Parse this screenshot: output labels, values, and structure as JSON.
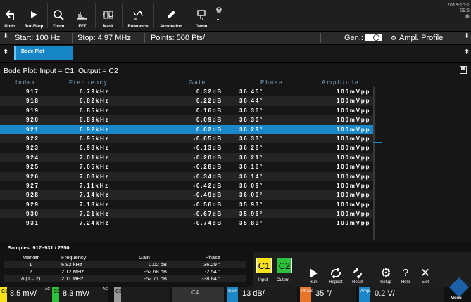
{
  "toolbar": {
    "undo": "Undo",
    "run_stop": "Run/Stop",
    "zoom": "Zoom",
    "fft": "FFT",
    "mask": "Mask",
    "reference": "Reference",
    "annotation": "Annotation",
    "demo": "Demo",
    "date": "2018-10-1",
    "time": "09:5"
  },
  "info": {
    "start": "Start: 100 Hz",
    "stop": "Stop: 4.97 MHz",
    "points": "Points: 500 Pts/",
    "gen": "Gen.:",
    "ampl_profile": "Ampl. Profile"
  },
  "tabs": {
    "bode": "Bode Plot"
  },
  "panel": {
    "title": "Bode Plot: Input = C1, Output = C2",
    "headers": [
      "Index",
      "Frequency",
      "Gain",
      "Phase",
      "Amplitude"
    ],
    "rows": [
      {
        "index": "917",
        "frequency": "6.79kHz",
        "gain": "0.32dB",
        "phase": "36.45°",
        "amplitude": "100mVpp"
      },
      {
        "index": "918",
        "frequency": "6.82kHz",
        "gain": "0.22dB",
        "phase": "36.44°",
        "amplitude": "100mVpp"
      },
      {
        "index": "919",
        "frequency": "6.85kHz",
        "gain": "0.16dB",
        "phase": "36.36°",
        "amplitude": "100mVpp"
      },
      {
        "index": "920",
        "frequency": "6.89kHz",
        "gain": "0.09dB",
        "phase": "36.30°",
        "amplitude": "100mVpp"
      },
      {
        "index": "921",
        "frequency": "6.92kHz",
        "gain": "0.02dB",
        "phase": "36.29°",
        "amplitude": "100mVpp"
      },
      {
        "index": "922",
        "frequency": "6.95kHz",
        "gain": "-0.05dB",
        "phase": "36.33°",
        "amplitude": "100mVpp"
      },
      {
        "index": "923",
        "frequency": "6.98kHz",
        "gain": "-0.13dB",
        "phase": "36.28°",
        "amplitude": "100mVpp"
      },
      {
        "index": "924",
        "frequency": "7.01kHz",
        "gain": "-0.20dB",
        "phase": "36.21°",
        "amplitude": "100mVpp"
      },
      {
        "index": "925",
        "frequency": "7.05kHz",
        "gain": "-0.28dB",
        "phase": "36.16°",
        "amplitude": "100mVpp"
      },
      {
        "index": "926",
        "frequency": "7.08kHz",
        "gain": "-0.34dB",
        "phase": "36.14°",
        "amplitude": "100mVpp"
      },
      {
        "index": "927",
        "frequency": "7.11kHz",
        "gain": "-0.42dB",
        "phase": "36.09°",
        "amplitude": "100mVpp"
      },
      {
        "index": "928",
        "frequency": "7.14kHz",
        "gain": "-0.49dB",
        "phase": "36.00°",
        "amplitude": "100mVpp"
      },
      {
        "index": "929",
        "frequency": "7.18kHz",
        "gain": "-0.56dB",
        "phase": "35.93°",
        "amplitude": "100mVpp"
      },
      {
        "index": "930",
        "frequency": "7.21kHz",
        "gain": "-0.67dB",
        "phase": "35.96°",
        "amplitude": "100mVpp"
      },
      {
        "index": "931",
        "frequency": "7.24kHz",
        "gain": "-0.74dB",
        "phase": "35.89°",
        "amplitude": "100mVpp"
      }
    ],
    "selected_index": 4
  },
  "samples": "Samples: 917–931 / 2350",
  "markers": {
    "headers": [
      "Marker",
      "Frequency",
      "Gain",
      "Phase"
    ],
    "rows": [
      {
        "marker": "1",
        "frequency": "6.92 kHz",
        "gain": "0.02 dB",
        "phase": "36.29 °"
      },
      {
        "marker": "2",
        "frequency": "2.12 MHz",
        "gain": "-52.68 dB",
        "phase": "-2.54 °"
      },
      {
        "marker": "Δ (1→2)",
        "frequency": "2.11 MHz",
        "gain": "-52.71 dB",
        "phase": "-38.84 °"
      }
    ]
  },
  "buttons": {
    "input_label": "Input",
    "output_label": "Output",
    "c1": "C1",
    "c2": "C2",
    "run": "Run",
    "repeat": "Repeat",
    "reset": "Reset",
    "setup": "Setup",
    "help": "Help",
    "exit": "Exit"
  },
  "channels": {
    "c1": {
      "tag": "C1",
      "value": "8.5 mV/",
      "coupling": "AC"
    },
    "c2": {
      "tag": "C2",
      "value": "8.3 mV/",
      "coupling": "AC"
    },
    "c3": {
      "tag": "C3"
    },
    "c4": {
      "tag": "C4"
    },
    "gain": {
      "tag": "Gain",
      "value": "13 dB/"
    },
    "phase": {
      "tag": "Phase",
      "value": "35 °/"
    },
    "ampl": {
      "tag": "Ampl.",
      "value": "0.2 V/"
    },
    "menu": "Menu"
  },
  "colors": {
    "accent": "#1a87c9",
    "c1": "#f7e21a",
    "c2": "#2ec13b",
    "gain": "#1a87c9",
    "phase": "#e8762a",
    "ampl": "#1a87c9"
  }
}
